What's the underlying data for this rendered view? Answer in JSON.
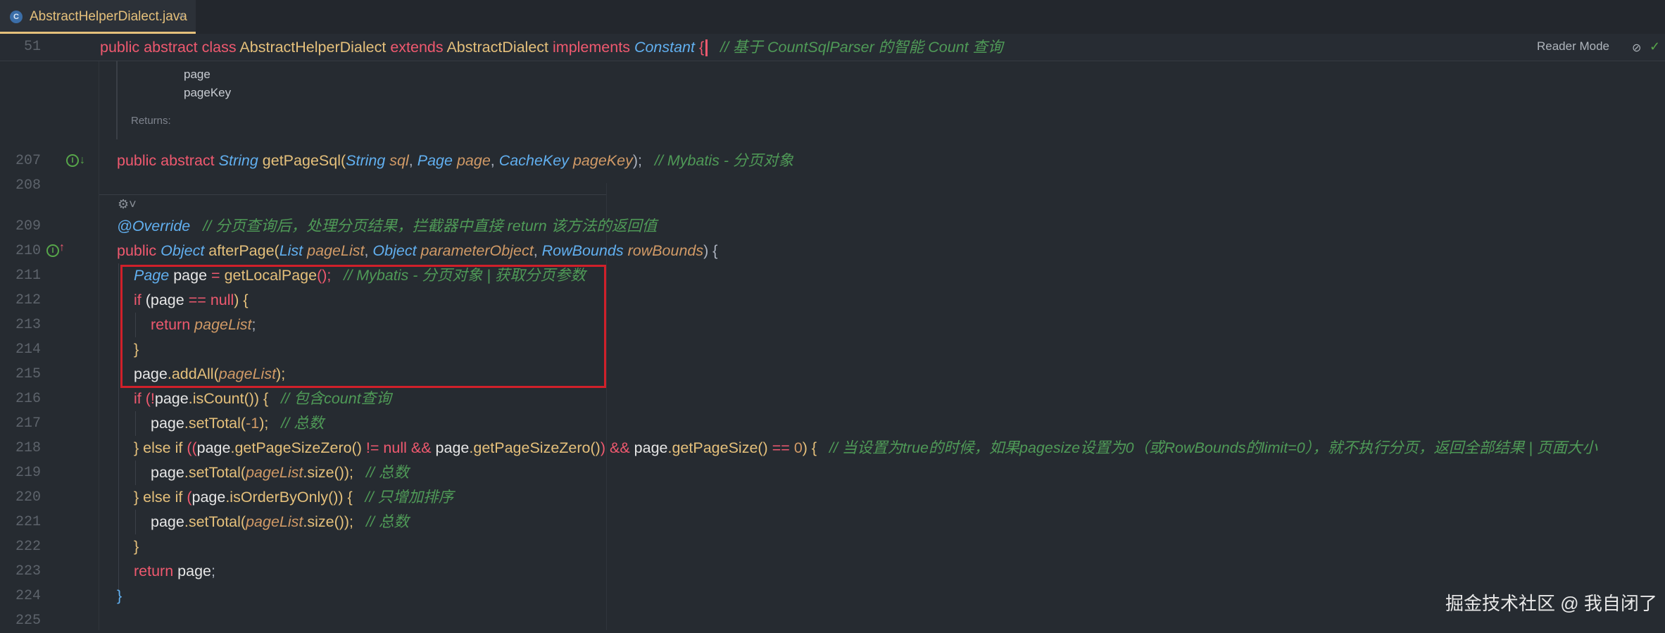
{
  "tab": {
    "label": "AbstractHelperDialect.java",
    "icon": "java-class-icon",
    "close": "×"
  },
  "sticky": {
    "line_number": "51",
    "code_public": "public",
    "code_abstract": "abstract",
    "code_class": "class",
    "class_name": "AbstractHelperDialect",
    "code_extends": "extends",
    "super_name": "AbstractDialect",
    "code_implements": "implements",
    "interface_name": "Constant",
    "brace": "{",
    "comment": "// 基于 CountSqlParser 的智能 Count 查询",
    "reader_mode": "Reader Mode"
  },
  "doc": {
    "param1": "page",
    "param2": "pageKey",
    "returns": "Returns:"
  },
  "colors": {
    "background": "#262b31",
    "keyword": "#ef596f",
    "class": "#e5c07b",
    "type": "#61afef",
    "param": "#d19a66",
    "comment": "#4f9a57",
    "highlight_box": "#d0202a"
  },
  "lines": {
    "l207": {
      "num": "207",
      "t1": "public",
      "t2": "abstract",
      "t3": "String",
      "t4": "getPageSql(",
      "t5": "String",
      "t6": "sql",
      "t7": ",",
      "t8": "Page",
      "t9": "page",
      "t10": ",",
      "t11": "CacheKey",
      "t12": "pageKey",
      "t13": ");",
      "comment": "// Mybatis - 分页对象"
    },
    "l208": {
      "num": "208"
    },
    "l209": {
      "num": "209",
      "annotation": "@Override",
      "comment": "// 分页查询后，处理分页结果，拦截器中直接 return 该方法的返回值"
    },
    "l210": {
      "num": "210",
      "t1": "public",
      "t2": "Object",
      "t3": "afterPage(",
      "t4": "List",
      "t5": "pageList",
      "t6": ",",
      "t7": "Object",
      "t8": "parameterObject",
      "t9": ",",
      "t10": "RowBounds",
      "t11": "rowBounds",
      "t12": ") {"
    },
    "l211": {
      "num": "211",
      "t1": "Page",
      "t2": "page",
      "t3": "=",
      "t4": "getLocalPage",
      "t5": "();",
      "comment": "// Mybatis - 分页对象 | 获取分页参数"
    },
    "l212": {
      "num": "212",
      "t1": "if",
      "t2": "(page",
      "t3": "==",
      "t4": "null",
      "t5": ") {"
    },
    "l213": {
      "num": "213",
      "t1": "return",
      "t2": "pageList",
      "t3": ";"
    },
    "l214": {
      "num": "214",
      "t1": "}"
    },
    "l215": {
      "num": "215",
      "t1": "page",
      "t2": ".addAll(",
      "t3": "pageList",
      "t4": ");"
    },
    "l216": {
      "num": "216",
      "t1": "if",
      "t2": "(!",
      "t3": "page",
      "t4": ".isCount()",
      "t5": ") {",
      "comment": "// 包含count查询"
    },
    "l217": {
      "num": "217",
      "t1": "page",
      "t2": ".setTotal(",
      "t3": "-1",
      "t4": ");",
      "comment": "// 总数"
    },
    "l218": {
      "num": "218",
      "t1": "} else if",
      "t2": "((",
      "t3": "page",
      "t4": ".getPageSizeZero()",
      "t5": "!=",
      "t6": "null",
      "t7": "&&",
      "t8": "page",
      "t9": ".getPageSizeZero()",
      "t10": ")",
      "t11": "&&",
      "t12": "page",
      "t13": ".getPageSize()",
      "t14": "==",
      "t15": "0",
      "t16": ") {",
      "comment": "// 当设置为true的时候，如果pagesize设置为0（或RowBounds的limit=0），就不执行分页，返回全部结果 | 页面大小"
    },
    "l219": {
      "num": "219",
      "t1": "page",
      "t2": ".setTotal(",
      "t3": "pageList",
      "t4": ".size());",
      "comment": "// 总数"
    },
    "l220": {
      "num": "220",
      "t1": "} else if",
      "t2": "(",
      "t3": "page",
      "t4": ".isOrderByOnly()",
      "t5": ") {",
      "comment": "// 只增加排序"
    },
    "l221": {
      "num": "221",
      "t1": "page",
      "t2": ".setTotal(",
      "t3": "pageList",
      "t4": ".size());",
      "comment": "// 总数"
    },
    "l222": {
      "num": "222",
      "t1": "}"
    },
    "l223": {
      "num": "223",
      "t1": "return",
      "t2": "page",
      "t3": ";"
    },
    "l224": {
      "num": "224",
      "t1": "}"
    },
    "l225": {
      "num": "225"
    }
  },
  "watermark": "掘金技术社区 @ 我自闭了"
}
